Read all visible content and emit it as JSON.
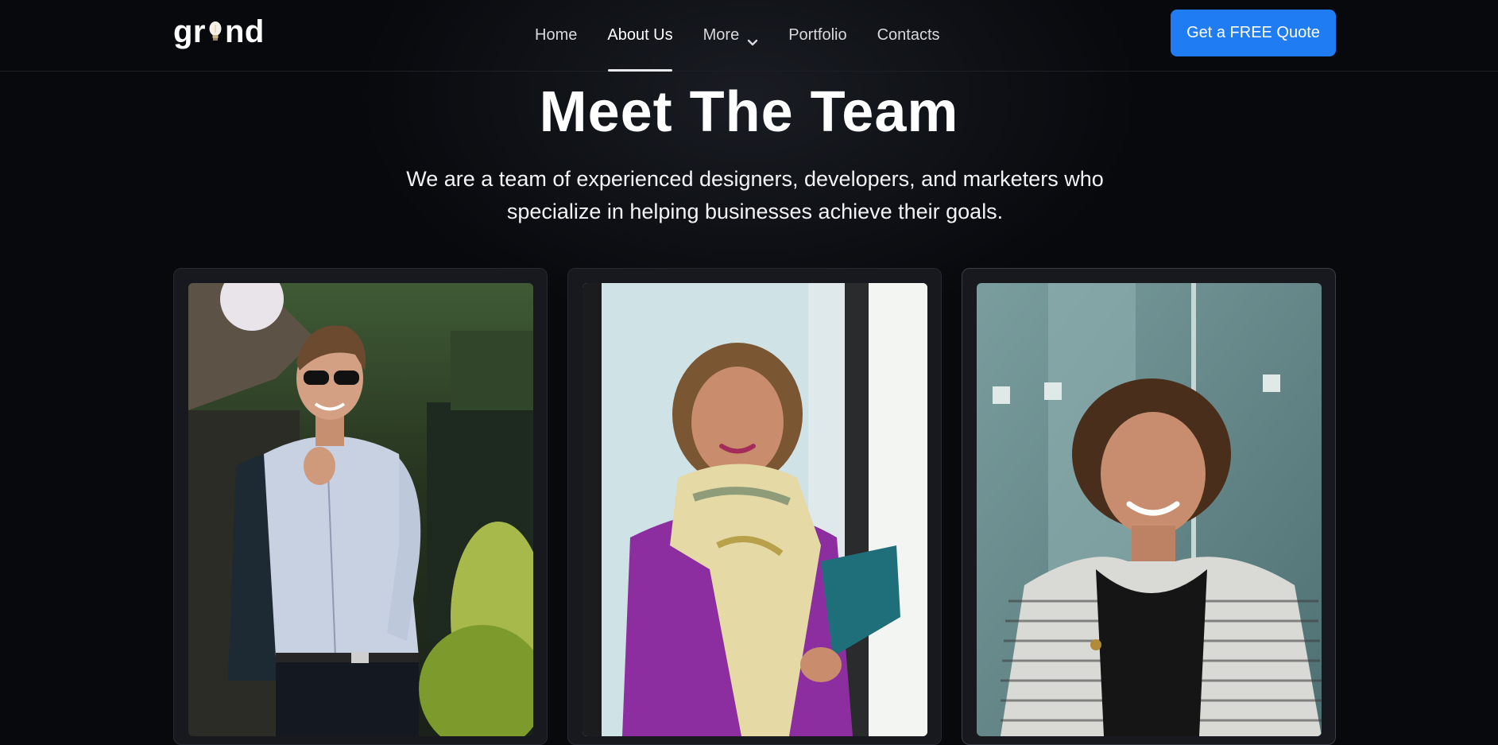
{
  "logo": {
    "prefix": "gr",
    "suffix": "nd"
  },
  "nav": {
    "items": [
      {
        "label": "Home"
      },
      {
        "label": "About Us",
        "active": true
      },
      {
        "label": "More",
        "has_dropdown": true
      },
      {
        "label": "Portfolio"
      },
      {
        "label": "Contacts"
      }
    ],
    "cta_label": "Get a FREE Quote"
  },
  "hero": {
    "title": "Meet The Team",
    "subtitle": "We are a team of experienced designers, developers, and marketers who specialize in helping businesses achieve their goals."
  },
  "team": {
    "members": [
      {
        "photo_icon": "man-portrait-photo"
      },
      {
        "photo_icon": "woman-with-scarf-portrait-photo"
      },
      {
        "photo_icon": "woman-smiling-portrait-photo"
      }
    ]
  },
  "colors": {
    "background": "#07090d",
    "accent": "#1f7cf2",
    "card": "#17191f"
  }
}
